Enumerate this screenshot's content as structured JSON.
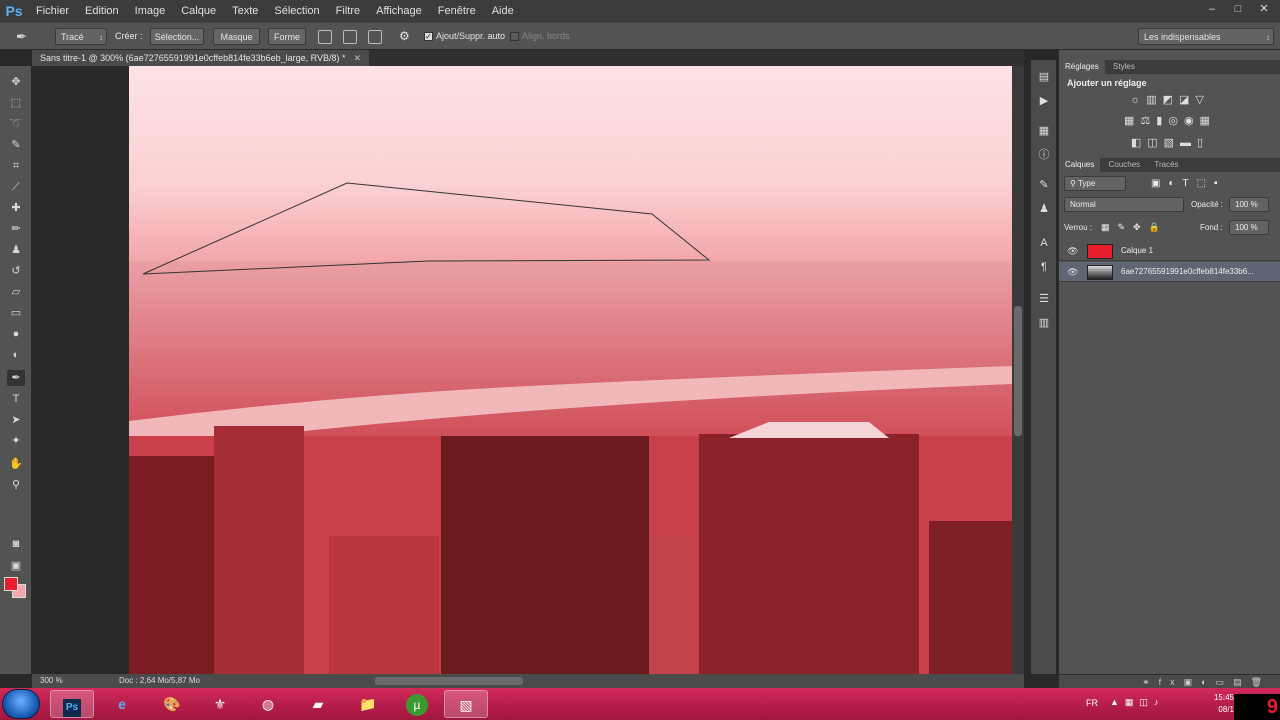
{
  "app": {
    "logo": "Ps"
  },
  "menu": [
    "Fichier",
    "Edition",
    "Image",
    "Calque",
    "Texte",
    "Sélection",
    "Filtre",
    "Affichage",
    "Fenêtre",
    "Aide"
  ],
  "window_controls": {
    "min": "–",
    "max": "□",
    "close": "✕"
  },
  "options": {
    "mode_value": "Tracé",
    "create_label": "Créer :",
    "selection_btn": "Sélection...",
    "mask_btn": "Masque",
    "shape_btn": "Forme",
    "auto_add_label": "Ajout/Suppr. auto",
    "auto_add_checked": true,
    "align_edges_label": "Align. bords",
    "align_edges_checked": false,
    "workspace_value": "Les indispensables"
  },
  "document": {
    "tab_title": "Sans titre-1 @ 300% (6ae72765591991e0cffeb814fe33b6eb_large, RVB/8) *",
    "zoom": "300 %",
    "doc_info": "Doc : 2,64 Mo/5,87 Mo"
  },
  "colors": {
    "foreground": "#e81e2e",
    "background": "#f4a8ae",
    "accent": "#5ab0f0"
  },
  "panels": {
    "adjust_tabs": [
      "Réglages",
      "Styles"
    ],
    "adjust_title": "Ajouter un réglage",
    "layer_tabs": [
      "Calques",
      "Couches",
      "Tracés"
    ],
    "filter_value": "Type",
    "blend_value": "Normal",
    "opacity_label": "Opacité :",
    "opacity_value": "100 %",
    "lock_label": "Verrou :",
    "fill_label": "Fond :",
    "fill_value": "100 %",
    "layers": [
      {
        "name": "Calque 1",
        "visible": true,
        "selected": false
      },
      {
        "name": "6ae72765591991e0cffeb814fe33b6...",
        "visible": true,
        "selected": true
      }
    ]
  },
  "taskbar": {
    "lang": "FR",
    "clock_time": "15:45",
    "clock_date": "08/1",
    "corner_mark": "9",
    "apps": [
      "windows-start",
      "photoshop",
      "internet-explorer",
      "paint",
      "skyrim",
      "firefox",
      "notepad",
      "folder",
      "utorrent",
      "game-app"
    ]
  }
}
